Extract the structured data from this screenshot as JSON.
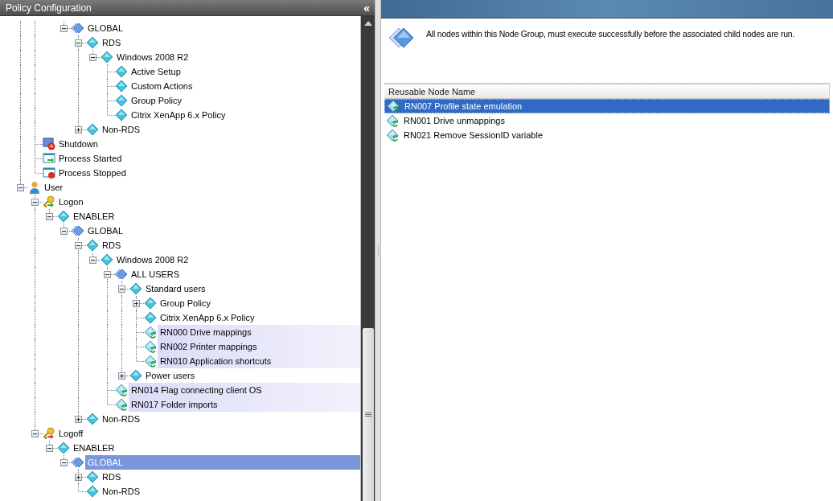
{
  "panel": {
    "title": "Policy Configuration",
    "collapse_glyph": "«"
  },
  "tree": [
    {
      "children": [
        {
          "children": [
            {
              "children": [
                {
                  "label": "GLOBAL",
                  "kind": "group",
                  "expanded": true,
                  "selected": false,
                  "children": [
                    {
                      "label": "RDS",
                      "kind": "node",
                      "expanded": true,
                      "selected": false,
                      "children": [
                        {
                          "label": "Windows 2008 R2",
                          "kind": "node",
                          "expanded": true,
                          "selected": false,
                          "children": [
                            {
                              "label": "Active Setup",
                              "kind": "node",
                              "selected": false
                            },
                            {
                              "label": "Custom Actions",
                              "kind": "node",
                              "selected": false
                            },
                            {
                              "label": "Group Policy",
                              "kind": "node",
                              "selected": false
                            },
                            {
                              "label": "Citrix XenApp 6.x Policy",
                              "kind": "node",
                              "selected": false
                            }
                          ]
                        }
                      ]
                    },
                    {
                      "label": "Non-RDS",
                      "kind": "node",
                      "expanded": false,
                      "selected": false
                    }
                  ]
                }
              ]
            }
          ]
        },
        {
          "label": "Shutdown",
          "kind": "shutdown",
          "selected": false
        },
        {
          "label": "Process Started",
          "kind": "process-start",
          "selected": false
        },
        {
          "label": "Process Stopped",
          "kind": "process-stop",
          "selected": false
        }
      ]
    },
    {
      "label": "User",
      "kind": "user",
      "expanded": true,
      "selected": false,
      "children": [
        {
          "label": "Logon",
          "kind": "logon",
          "expanded": true,
          "selected": false,
          "children": [
            {
              "label": "ENABLER",
              "kind": "node",
              "expanded": true,
              "selected": false,
              "children": [
                {
                  "label": "GLOBAL",
                  "kind": "group",
                  "expanded": true,
                  "selected": false,
                  "children": [
                    {
                      "label": "RDS",
                      "kind": "node",
                      "expanded": true,
                      "selected": false,
                      "children": [
                        {
                          "label": "Windows 2008 R2",
                          "kind": "node",
                          "expanded": true,
                          "selected": false,
                          "children": [
                            {
                              "label": "ALL USERS",
                              "kind": "group",
                              "expanded": true,
                              "selected": false,
                              "children": [
                                {
                                  "label": "Standard users",
                                  "kind": "node",
                                  "expanded": true,
                                  "selected": false,
                                  "children": [
                                    {
                                      "label": "Group Policy",
                                      "kind": "node",
                                      "expanded": false,
                                      "selected": false
                                    },
                                    {
                                      "label": "Citrix XenApp 6.x Policy",
                                      "kind": "node",
                                      "selected": false
                                    },
                                    {
                                      "label": "RN000 Drive mappings",
                                      "kind": "reusable",
                                      "selected": false
                                    },
                                    {
                                      "label": "RN002 Printer mappings",
                                      "kind": "reusable",
                                      "selected": false
                                    },
                                    {
                                      "label": "RN010 Application shortcuts",
                                      "kind": "reusable",
                                      "selected": false
                                    }
                                  ]
                                },
                                {
                                  "label": "Power users",
                                  "kind": "node",
                                  "expanded": false,
                                  "selected": false
                                }
                              ]
                            },
                            {
                              "label": "RN014 Flag connecting client OS",
                              "kind": "reusable",
                              "selected": false
                            },
                            {
                              "label": "RN017 Folder imports",
                              "kind": "reusable",
                              "selected": false
                            }
                          ]
                        }
                      ]
                    },
                    {
                      "label": "Non-RDS",
                      "kind": "node",
                      "expanded": false,
                      "selected": false
                    }
                  ]
                }
              ]
            }
          ]
        },
        {
          "label": "Logoff",
          "kind": "logoff",
          "expanded": true,
          "selected": false,
          "children": [
            {
              "label": "ENABLER",
              "kind": "node",
              "expanded": true,
              "selected": false,
              "children": [
                {
                  "label": "GLOBAL",
                  "kind": "group",
                  "expanded": true,
                  "selected": true,
                  "children": [
                    {
                      "label": "RDS",
                      "kind": "node",
                      "expanded": false,
                      "selected": false
                    },
                    {
                      "label": "Non-RDS",
                      "kind": "node",
                      "selected": false
                    }
                  ]
                }
              ]
            }
          ]
        }
      ]
    }
  ],
  "description": "All nodes within this Node Group, must execute successfully before the associated child nodes are run.",
  "table": {
    "columns": [
      "Reusable Node Name"
    ],
    "rows": [
      {
        "name": "RN007 Profile state emulation",
        "selected": true
      },
      {
        "name": "RN001 Drive unmappings",
        "selected": false
      },
      {
        "name": "RN021 Remove SessionID variable",
        "selected": false
      }
    ]
  }
}
